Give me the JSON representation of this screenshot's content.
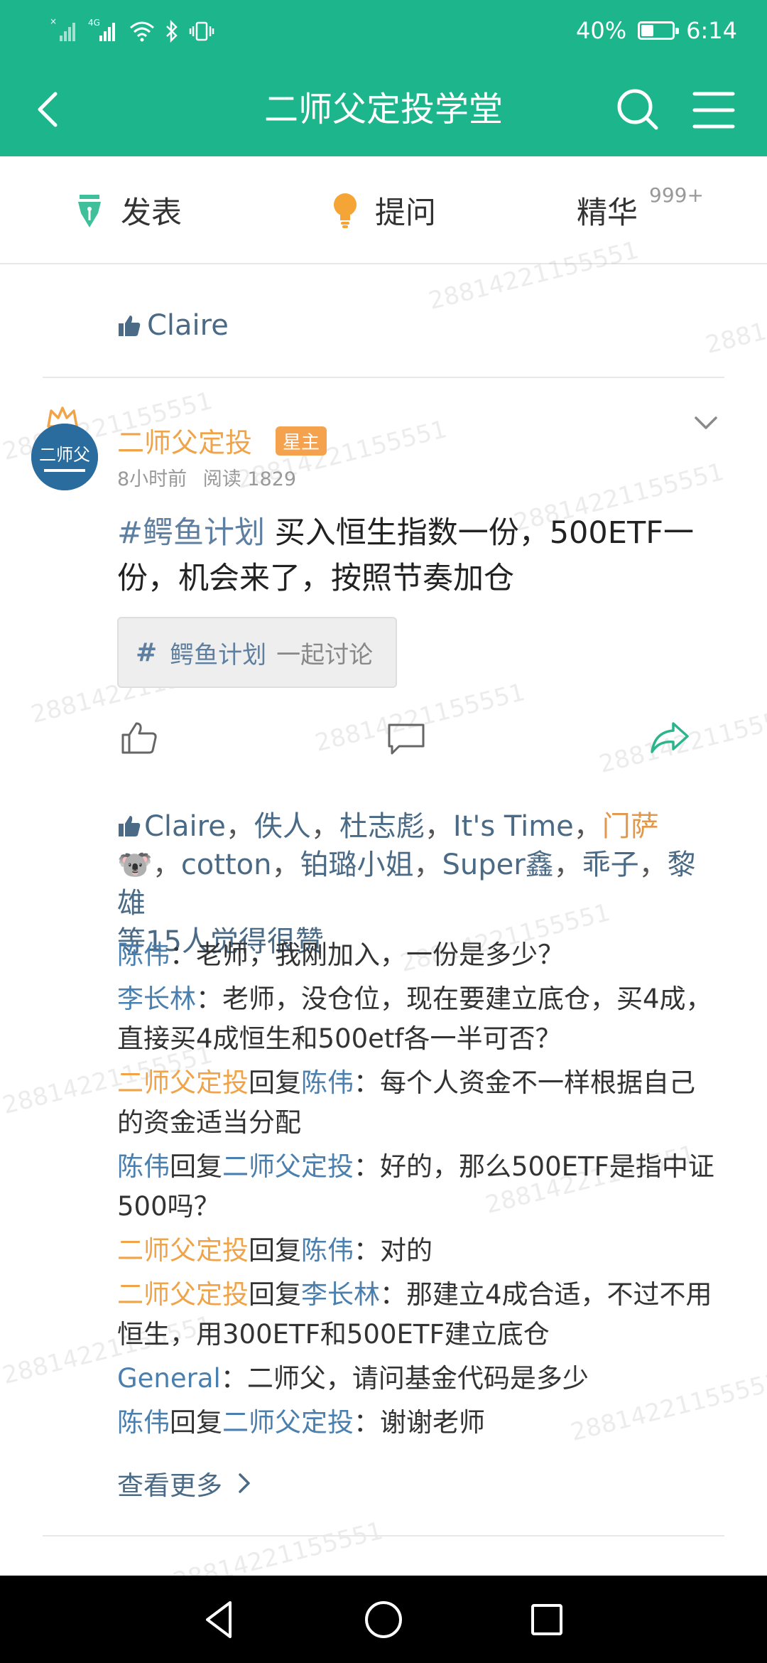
{
  "status_bar": {
    "signal_icons": [
      "sim-off-signal-icon",
      "4g-signal-icon",
      "wifi-icon",
      "bluetooth-icon",
      "vibrate-icon"
    ],
    "network_label": "4G",
    "battery_percent": "40%",
    "battery_level": 0.4,
    "time": "6:14"
  },
  "app_bar": {
    "title": "二师父定投学堂"
  },
  "toolbar": {
    "post_label": "发表",
    "ask_label": "提问",
    "featured_label": "精华",
    "featured_count": "999+"
  },
  "watermark_text": "28814221155551",
  "prev_post": {
    "likes": "Claire"
  },
  "post": {
    "author": "二师父定投",
    "author_badge": "星主",
    "time": "8小时前",
    "read_label": "阅读",
    "read_count": "1829",
    "hashtag": "#鳄鱼计划",
    "body": "买入恒生指数一份，500ETF一份，机会来了，按照节奏加仓",
    "topic_symbol": "#",
    "topic_name": "鳄鱼计划",
    "topic_tail": "一起讨论",
    "avatar_text": "二师父"
  },
  "likes": {
    "names": [
      "Claire",
      "佚人",
      "杜志彪",
      "It's Time",
      "门萨",
      "cotton",
      "铂璐小姐",
      "Super鑫",
      "乖子",
      "黎雄"
    ],
    "emoji": "🐨",
    "summary": "等15人觉得很赞"
  },
  "comments": [
    {
      "from": "陈伟",
      "reply_word": "",
      "to": "",
      "text": "：老师，我刚加入，一份是多少？"
    },
    {
      "from": "李长林",
      "reply_word": "",
      "to": "",
      "text": "：老师，没仓位，现在要建立底仓，买4成，直接买4成恒生和500etf各一半可否？"
    },
    {
      "from": "二师父定投",
      "reply_word": "回复",
      "to": "陈伟",
      "text": "：每个人资金不一样根据自己的资金适当分配"
    },
    {
      "from": "陈伟",
      "reply_word": "回复",
      "to": "二师父定投",
      "text": "：好的，那么500ETF是指中证500吗？"
    },
    {
      "from": "二师父定投",
      "reply_word": "回复",
      "to": "陈伟",
      "text": "：对的"
    },
    {
      "from": "二师父定投",
      "reply_word": "回复",
      "to": "李长林",
      "text": "：那建立4成合适，不过不用恒生，用300ETF和500ETF建立底仓"
    },
    {
      "from": "General",
      "reply_word": "",
      "to": "",
      "text": "：二师父，请问基金代码是多少"
    },
    {
      "from": "陈伟",
      "reply_word": "回复",
      "to": "二师父定投",
      "text": "：谢谢老师"
    }
  ],
  "see_more": "查看更多",
  "colors": {
    "brand_green": "#1cb58c",
    "author_orange": "#f0a44a",
    "link_blue": "#4a7fae"
  }
}
